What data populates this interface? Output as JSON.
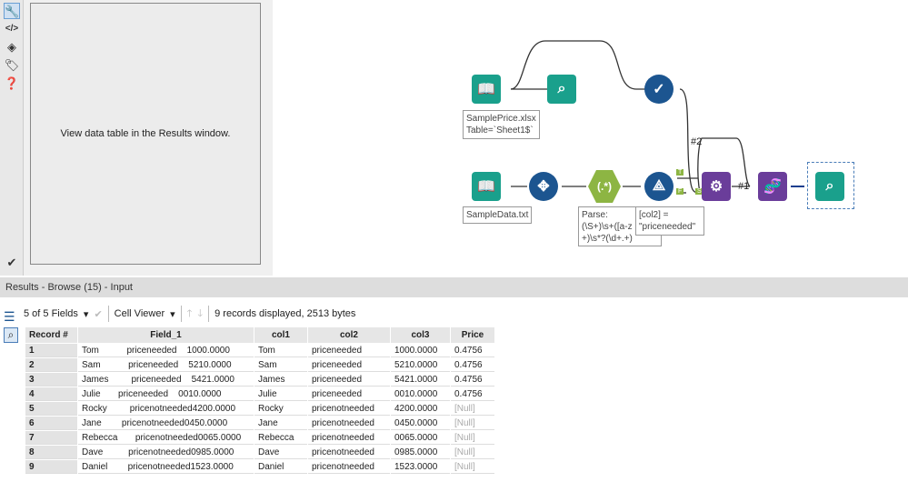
{
  "left_toolbar": {
    "icons": [
      "wrench-icon",
      "code-icon",
      "compass-icon",
      "tag-icon",
      "help-icon",
      "checkmark-circle-icon"
    ]
  },
  "config": {
    "message": "View data table in the Results window."
  },
  "canvas": {
    "annotations": {
      "sampleprice": "SamplePrice.xlsx\nTable=`Sheet1$`",
      "sampledata": "SampleData.txt",
      "parse": "Parse:\n(\\S+)\\s+([a-z\n+)\\s*?(\\d+.+)",
      "filter": "[col2] =\n\"priceneeded\""
    },
    "labels": {
      "hash2": "#2",
      "hash1": "#1",
      "regex_glyph": "(.*)",
      "t": "T",
      "f": "F",
      "s": "S"
    }
  },
  "results": {
    "title": "Results - Browse (15) - Input",
    "fields_label": "5 of 5 Fields",
    "viewer_label": "Cell Viewer",
    "status": "9 records displayed, 2513 bytes",
    "columns": [
      "Record #",
      "Field_1",
      "col1",
      "col2",
      "col3",
      "Price"
    ],
    "rows": [
      [
        "1",
        "Tom           priceneeded    1000.0000",
        "Tom",
        "priceneeded",
        "1000.0000",
        "0.4756"
      ],
      [
        "2",
        "Sam           priceneeded    5210.0000",
        "Sam",
        "priceneeded",
        "5210.0000",
        "0.4756"
      ],
      [
        "3",
        "James         priceneeded    5421.0000",
        "James",
        "priceneeded",
        "5421.0000",
        "0.4756"
      ],
      [
        "4",
        "Julie       priceneeded    0010.0000",
        "Julie",
        "priceneeded",
        "0010.0000",
        "0.4756"
      ],
      [
        "5",
        "Rocky         pricenotneeded4200.0000",
        "Rocky",
        "pricenotneeded",
        "4200.0000",
        "[Null]"
      ],
      [
        "6",
        "Jane        pricenotneeded0450.0000",
        "Jane",
        "pricenotneeded",
        "0450.0000",
        "[Null]"
      ],
      [
        "7",
        "Rebecca       pricenotneeded0065.0000",
        "Rebecca",
        "pricenotneeded",
        "0065.0000",
        "[Null]"
      ],
      [
        "8",
        "Dave          pricenotneeded0985.0000",
        "Dave",
        "pricenotneeded",
        "0985.0000",
        "[Null]"
      ],
      [
        "9",
        "Daniel        pricenotneeded1523.0000",
        "Daniel",
        "pricenotneeded",
        "1523.0000",
        "[Null]"
      ]
    ]
  }
}
